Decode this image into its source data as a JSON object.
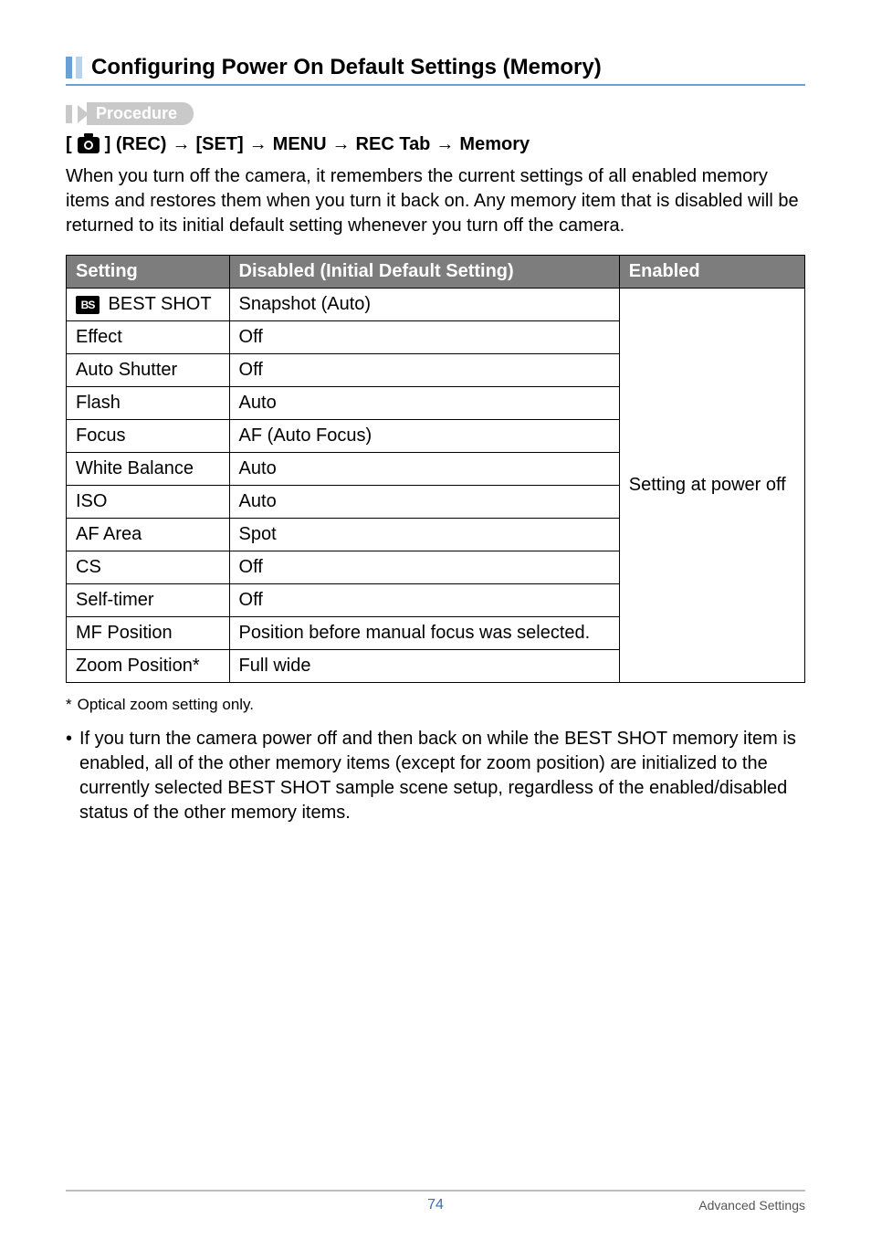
{
  "heading": {
    "title": "Configuring Power On Default Settings (Memory)"
  },
  "procedure": {
    "label": "Procedure",
    "p0": "[",
    "p1": "] (REC)",
    "p2": "[SET]",
    "p3": "MENU",
    "p4": "REC Tab",
    "p5": "Memory",
    "arrow": "→"
  },
  "body": "When you turn off the camera, it remembers the current settings of all enabled memory items and restores them when you turn it back on. Any memory item that is disabled will be returned to its initial default setting whenever you turn off the camera.",
  "table": {
    "h_setting": "Setting",
    "h_disabled": "Disabled (Initial Default Setting)",
    "h_enabled": "Enabled",
    "rows": [
      {
        "setting_prefix_icon": "BS",
        "setting": " BEST SHOT",
        "disabled": "Snapshot (Auto)"
      },
      {
        "setting": "Effect",
        "disabled": "Off"
      },
      {
        "setting": "Auto Shutter",
        "disabled": "Off"
      },
      {
        "setting": "Flash",
        "disabled": "Auto"
      },
      {
        "setting": "Focus",
        "disabled": "AF (Auto Focus)"
      },
      {
        "setting": "White Balance",
        "disabled": "Auto"
      },
      {
        "setting": "ISO",
        "disabled": "Auto"
      },
      {
        "setting": "AF Area",
        "disabled": "Spot"
      },
      {
        "setting": "CS",
        "disabled": "Off"
      },
      {
        "setting": "Self-timer",
        "disabled": "Off"
      },
      {
        "setting": "MF Position",
        "disabled": "Position before manual focus was selected."
      },
      {
        "setting": "Zoom Position*",
        "disabled": "Full wide"
      }
    ],
    "enabled_text": "Setting at power off"
  },
  "footnote": {
    "marker": "*",
    "text": "Optical zoom setting only."
  },
  "note": {
    "bullet": "•",
    "text": "If you turn the camera power off and then back on while the BEST SHOT memory item is enabled, all of the other memory items (except for zoom position) are initialized to the currently selected BEST SHOT sample scene setup, regardless of the enabled/disabled status of the other memory items."
  },
  "footer": {
    "page": "74",
    "section": "Advanced Settings"
  }
}
